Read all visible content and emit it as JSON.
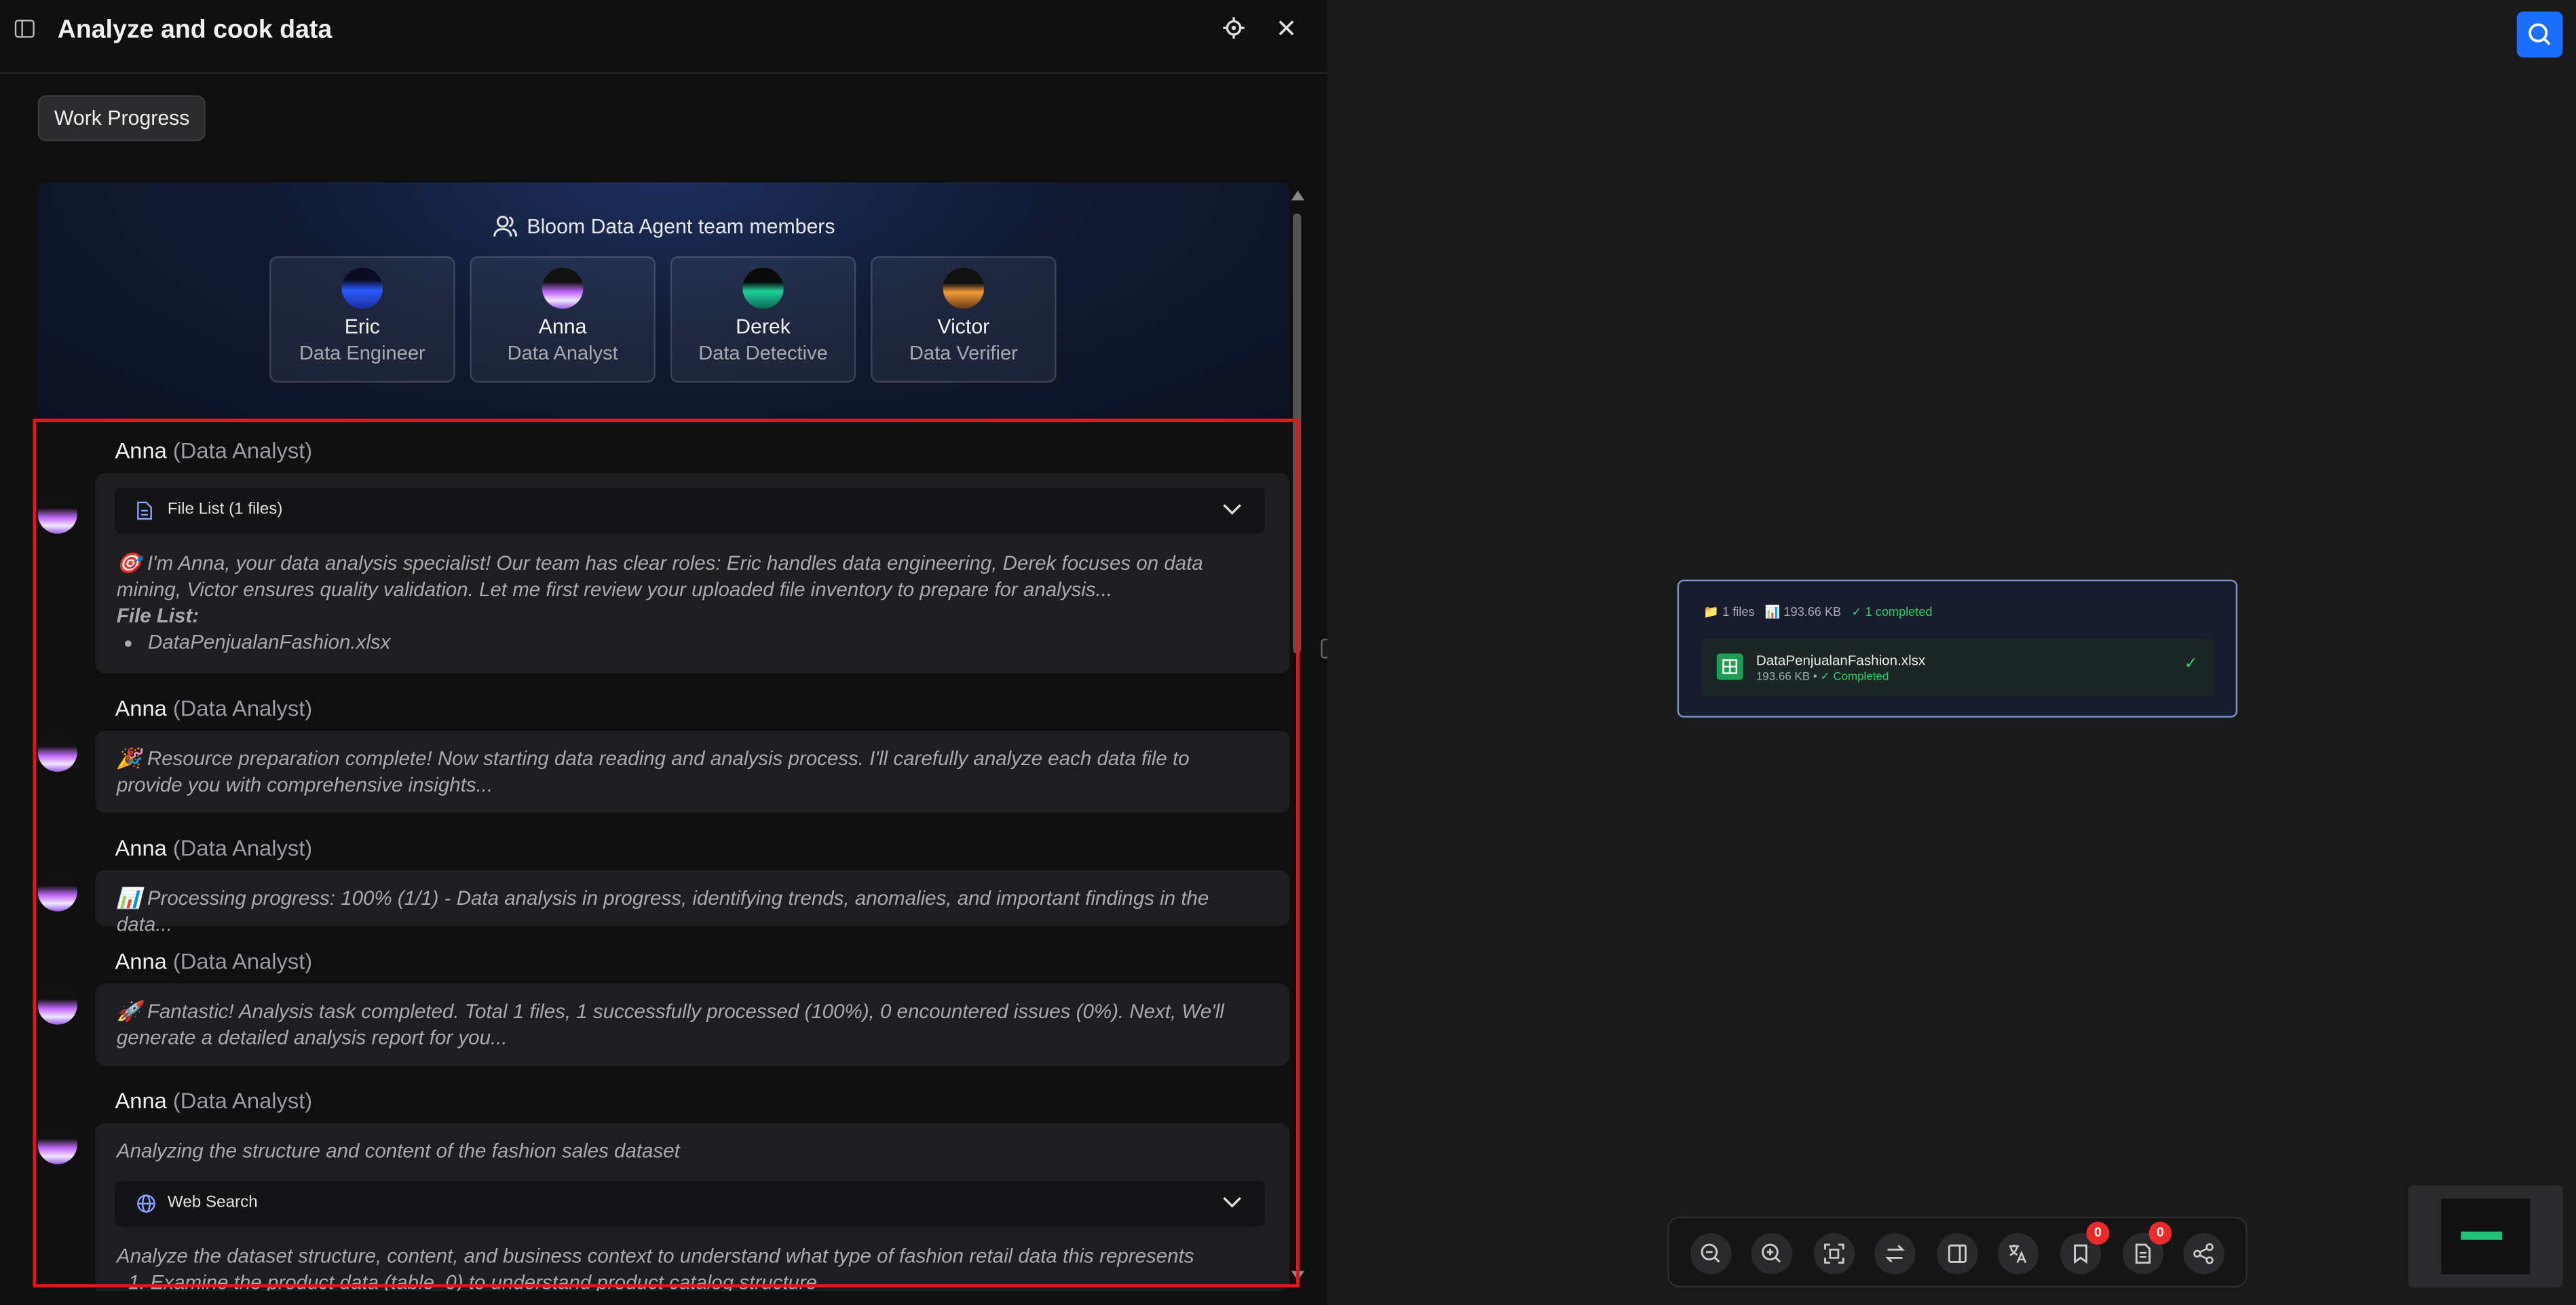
{
  "header": {
    "title": "Analyze and cook data"
  },
  "tabs": {
    "work_progress": "Work Progress"
  },
  "team": {
    "title": "Bloom Data Agent team members",
    "members": [
      {
        "name": "Eric",
        "role": "Data Engineer"
      },
      {
        "name": "Anna",
        "role": "Data Analyst"
      },
      {
        "name": "Derek",
        "role": "Data Detective"
      },
      {
        "name": "Victor",
        "role": "Data Verifier"
      }
    ]
  },
  "messages": [
    {
      "author": "Anna",
      "role": "(Data Analyst)",
      "tool": "File List (1 files)",
      "text": "🎯 I'm Anna, your data analysis specialist! Our team has clear roles: Eric handles data engineering, Derek focuses on data mining, Victor ensures quality validation. Let me first review your uploaded file inventory to prepare for analysis...",
      "file_list_label": "File List:",
      "files": [
        "DataPenjualanFashion.xlsx"
      ]
    },
    {
      "author": "Anna",
      "role": "(Data Analyst)",
      "text": "🎉 Resource preparation complete! Now starting data reading and analysis process. I'll carefully analyze each data file to provide you with comprehensive insights..."
    },
    {
      "author": "Anna",
      "role": "(Data Analyst)",
      "text": "📊 Processing progress: 100% (1/1) - Data analysis in progress, identifying trends, anomalies, and important findings in the data..."
    },
    {
      "author": "Anna",
      "role": "(Data Analyst)",
      "text": "🚀 Fantastic! Analysis task completed. Total 1 files, 1 successfully processed (100%), 0 encountered issues (0%). Next, We'll generate a detailed analysis report for you..."
    },
    {
      "author": "Anna",
      "role": "(Data Analyst)",
      "intro": "Analyzing the structure and content of the fashion sales dataset",
      "tool": "Web Search",
      "text": "Analyze the dataset structure, content, and business context to understand what type of fashion retail data this represents",
      "steps": [
        "1. Examine the product data (table_0) to understand product catalog structure"
      ]
    }
  ],
  "file_card": {
    "files_count": "1 files",
    "total_size": "193.66 KB",
    "completed": "✓ 1 completed",
    "file_name": "DataPenjualanFashion.xlsx",
    "file_size": "193.66 KB",
    "separator": "•",
    "file_status": "✓ Completed"
  },
  "toolbar": {
    "bookmark_badge": "0",
    "notes_badge": "0"
  }
}
